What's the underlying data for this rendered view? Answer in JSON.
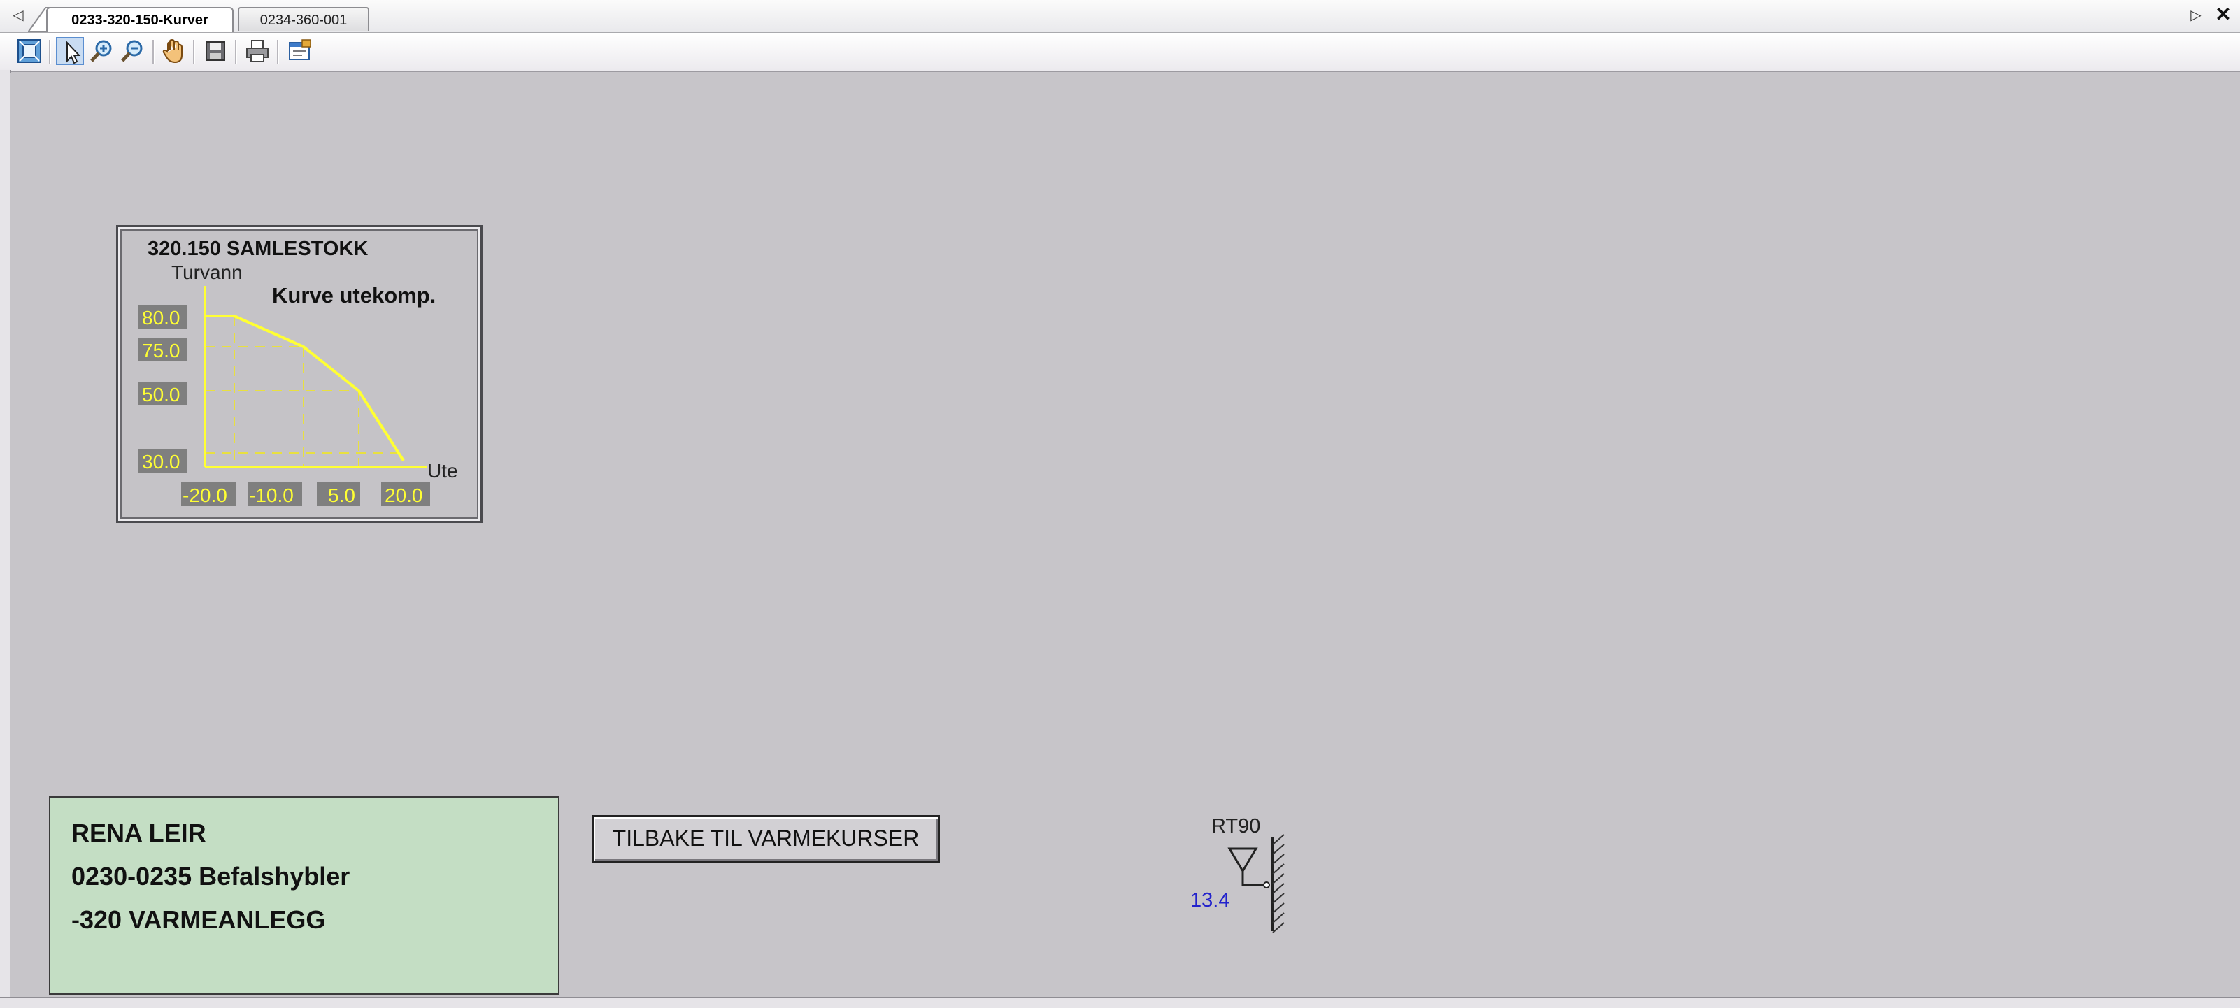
{
  "tabs": [
    {
      "label": "0233-320-150-Kurver",
      "active": true
    },
    {
      "label": "0234-360-001",
      "active": false
    }
  ],
  "tabbar": {
    "scroll_left_icon": "triangle-left-icon",
    "scroll_right_icon": "triangle-right-icon",
    "close_icon": "close-icon"
  },
  "toolbar": {
    "items": [
      "zoom-to-fit-icon",
      "select-pointer-icon",
      "zoom-in-icon",
      "zoom-out-icon",
      "pan-hand-icon",
      "save-icon",
      "print-icon",
      "properties-icon"
    ],
    "active_item": "select-pointer-icon"
  },
  "curve_panel": {
    "title": "320.150 SAMLESTOKK",
    "y_axis_label": "Turvann",
    "x_axis_label": "Ute",
    "heading": "Kurve utekomp.",
    "y_values": [
      "80.0",
      "75.0",
      "50.0",
      "30.0"
    ],
    "x_values": [
      "-20.0",
      "-10.0",
      "5.0",
      "20.0"
    ],
    "line_color": "#ffff33",
    "value_box_color": "#7f7f7f"
  },
  "info": {
    "line1": "RENA LEIR",
    "line2": "0230-0235 Befalshybler",
    "line3": "-320 VARMEANLEGG",
    "background": "#c4dec4"
  },
  "back_button": {
    "label": "TILBAKE TIL VARMEKURSER"
  },
  "sensor": {
    "name": "RT90",
    "value": "13.4",
    "value_color": "#2222cc"
  }
}
